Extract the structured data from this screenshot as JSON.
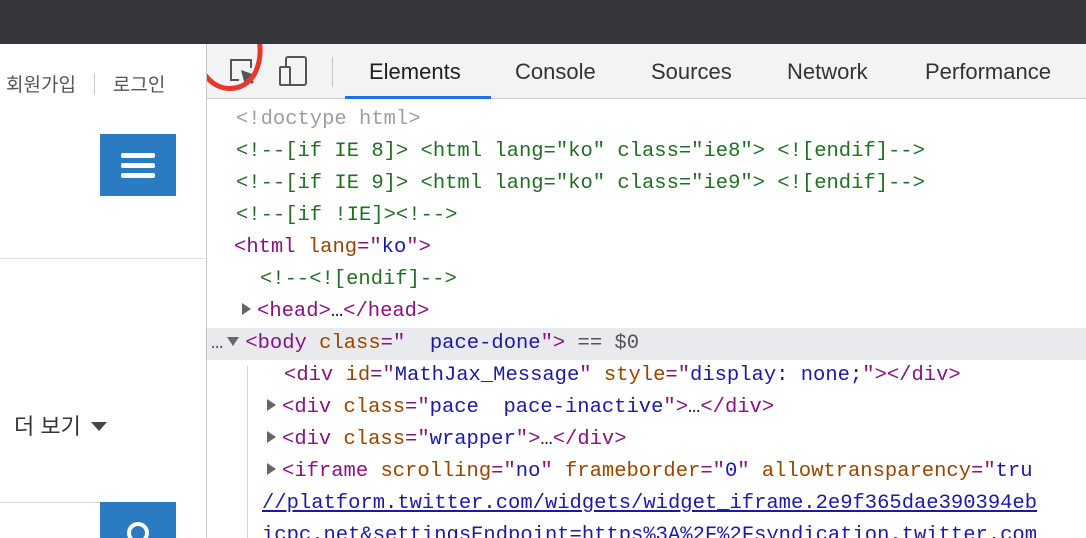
{
  "page": {
    "signup": "회원가입",
    "login": "로그인",
    "more": "더 보기"
  },
  "devtools": {
    "tabs": [
      "Elements",
      "Console",
      "Sources",
      "Network",
      "Performance"
    ],
    "active_tab": "Elements",
    "dom": {
      "doctype": "<!doctype html>",
      "ie8_comment": "<!--[if IE 8]> <html lang=\"ko\" class=\"ie8\"> <![endif]-->",
      "ie9_comment": "<!--[if IE 9]> <html lang=\"ko\" class=\"ie9\"> <![endif]-->",
      "notie_comment": "<!--[if !IE]><!-->",
      "html_tag": {
        "name": "html",
        "attr": "lang",
        "value": "ko"
      },
      "endif_comment": "<!--<![endif]-->",
      "head": {
        "name": "head",
        "ellipsis": "…"
      },
      "body": {
        "name": "body",
        "attr": "class",
        "value": "  pace-done",
        "eq": "== $0"
      },
      "mathjax": {
        "name": "div",
        "attr1": "id",
        "val1": "MathJax_Message",
        "attr2": "style",
        "val2": "display: none;"
      },
      "pace_div": {
        "name": "div",
        "attr": "class",
        "value": "pace  pace-inactive",
        "ellipsis": "…"
      },
      "wrapper_div": {
        "name": "div",
        "attr": "class",
        "value": "wrapper",
        "ellipsis": "…"
      },
      "iframe": {
        "name": "iframe",
        "attr1": "scrolling",
        "val1": "no",
        "attr2": "frameborder",
        "val2": "0",
        "attr3": "allowtransparency",
        "val3": "tru"
      },
      "url_line_1": "//platform.twitter.com/widgets/widget_iframe.2e9f365dae390394eb",
      "url_line_2": "icpc.net&settingsEndpoint=https%3A%2F%2Fsyndication.twitter.com"
    }
  },
  "colors": {
    "annotation_circle": "#e8372c",
    "accent_tab": "#1a73e8",
    "page_button": "#2b7bc3"
  },
  "icons": [
    "inspect-element-icon",
    "device-toolbar-icon",
    "hamburger-menu-icon",
    "search-icon",
    "caret-down-icon"
  ]
}
